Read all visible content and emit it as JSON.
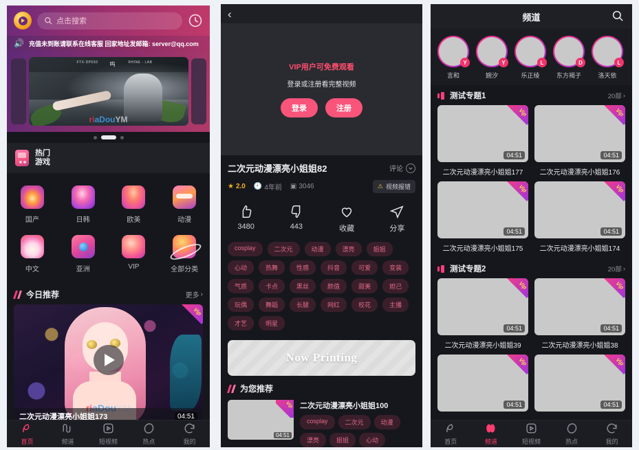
{
  "panel1": {
    "search": {
      "placeholder": "点击搜索",
      "icon": "search-icon"
    },
    "logo_name": "app-logo",
    "history_icon": "clock-icon",
    "notice": {
      "icon": "speaker-icon",
      "text": "充值未到账请联系在线客服 回家地址发邮箱: server@qq.com"
    },
    "banner": {
      "watermark_a": "ri",
      "watermark_b": "aDou",
      "watermark_c": "YM",
      "mark1": "FTX-DP593",
      "mark2": "呜",
      "mark3": "RHINE - LAB"
    },
    "carousel_dots": 3,
    "carousel_active_index": 1,
    "hot_game": {
      "line1": "热门",
      "line2": "游戏",
      "icon": "game-card-icon"
    },
    "categories": [
      {
        "label": "国产",
        "icon": "flame-icon"
      },
      {
        "label": "日韩",
        "icon": "lips-icon"
      },
      {
        "label": "欧美",
        "icon": "body-icon"
      },
      {
        "label": "动漫",
        "icon": "mask-icon"
      },
      {
        "label": "中文",
        "icon": "flower-icon"
      },
      {
        "label": "亚洲",
        "icon": "camera-icon"
      },
      {
        "label": "VIP",
        "icon": "peach-icon"
      },
      {
        "label": "全部分类",
        "icon": "planet-icon"
      }
    ],
    "today": {
      "title": "今日推荐",
      "more": "更多"
    },
    "featured_card": {
      "title": "二次元动漫漂亮小姐姐173",
      "duration": "04:51",
      "vip_badge": "Vip",
      "play_icon": "play-icon"
    },
    "tabs": [
      {
        "label": "首页",
        "icon": "home-icon",
        "active": true
      },
      {
        "label": "频道",
        "icon": "channel-icon",
        "active": false
      },
      {
        "label": "短视频",
        "icon": "short-video-icon",
        "active": false
      },
      {
        "label": "热点",
        "icon": "hot-icon",
        "active": false
      },
      {
        "label": "我的",
        "icon": "profile-icon",
        "active": false
      }
    ]
  },
  "panel2": {
    "back_icon": "back-chevron-icon",
    "player": {
      "vip_line": "VIP用户可免费观看",
      "sub_line": "登录或注册看完整视频",
      "login_label": "登录",
      "register_label": "注册"
    },
    "video": {
      "title": "二次元动漫漂亮小姐姐82",
      "comment_label": "评论",
      "rating": "2.0",
      "age": "4年前",
      "views": "3046",
      "report_label": "视频报错"
    },
    "actions": [
      {
        "label": "3480",
        "icon": "thumb-up-icon"
      },
      {
        "label": "443",
        "icon": "thumb-down-icon"
      },
      {
        "label": "收藏",
        "icon": "heart-icon"
      },
      {
        "label": "分享",
        "icon": "share-icon"
      }
    ],
    "tags": [
      "cosplay",
      "二次元",
      "动漫",
      "漂亮",
      "姐姐",
      "心动",
      "热舞",
      "性感",
      "抖音",
      "可爱",
      "变装",
      "气质",
      "卡点",
      "黑丝",
      "颜值",
      "甜美",
      "妲己",
      "玩偶",
      "舞蹈",
      "长腿",
      "网红",
      "校花",
      "主播",
      "才艺",
      "明星"
    ],
    "ad": {
      "text": "Now Printing"
    },
    "recommend": {
      "title": "为您推荐"
    },
    "rec_item": {
      "title": "二次元动漫漂亮小姐姐100",
      "duration": "04:51",
      "vip_badge": "Vip",
      "tags": [
        "cosplay",
        "二次元",
        "动漫",
        "漂亮",
        "姐姐",
        "心动"
      ]
    }
  },
  "panel3": {
    "header": {
      "title": "频道",
      "search_icon": "search-icon"
    },
    "avatars": [
      {
        "name": "言和",
        "badge": "Y"
      },
      {
        "name": "婉汐",
        "badge": "Y"
      },
      {
        "name": "乐正绫",
        "badge": "L"
      },
      {
        "name": "东方褐子",
        "badge": "D"
      },
      {
        "name": "洛天依",
        "badge": "L"
      }
    ],
    "sections": [
      {
        "title": "测试专题1",
        "count": "20部",
        "items": [
          {
            "title": "二次元动漫漂亮小姐姐177",
            "duration": "04:51",
            "vip_badge": "Vip"
          },
          {
            "title": "二次元动漫漂亮小姐姐176",
            "duration": "04:51",
            "vip_badge": "Vip"
          },
          {
            "title": "二次元动漫漂亮小姐姐175",
            "duration": "04:51",
            "vip_badge": "Vip"
          },
          {
            "title": "二次元动漫漂亮小姐姐174",
            "duration": "04:51",
            "vip_badge": "Vip"
          }
        ]
      },
      {
        "title": "测试专题2",
        "count": "20部",
        "items": [
          {
            "title": "二次元动漫漂亮小姐姐39",
            "duration": "04:51",
            "vip_badge": "Vip"
          },
          {
            "title": "二次元动漫漂亮小姐姐38",
            "duration": "04:51",
            "vip_badge": "Vip"
          },
          {
            "title": "",
            "duration": "04:51",
            "vip_badge": "Vip"
          },
          {
            "title": "",
            "duration": "04:51",
            "vip_badge": "Vip"
          }
        ]
      }
    ],
    "tabs": [
      {
        "label": "首页",
        "icon": "home-icon",
        "active": false
      },
      {
        "label": "频道",
        "icon": "channel-icon",
        "active": true
      },
      {
        "label": "短视频",
        "icon": "short-video-icon",
        "active": false
      },
      {
        "label": "热点",
        "icon": "hot-icon",
        "active": false
      },
      {
        "label": "我的",
        "icon": "profile-icon",
        "active": false
      }
    ]
  },
  "colors": {
    "accent_pink": "#ff3d7a",
    "vip_gold": "#ffd84d",
    "button_pink": "#f9547a",
    "star_gold": "#f2b11e"
  }
}
